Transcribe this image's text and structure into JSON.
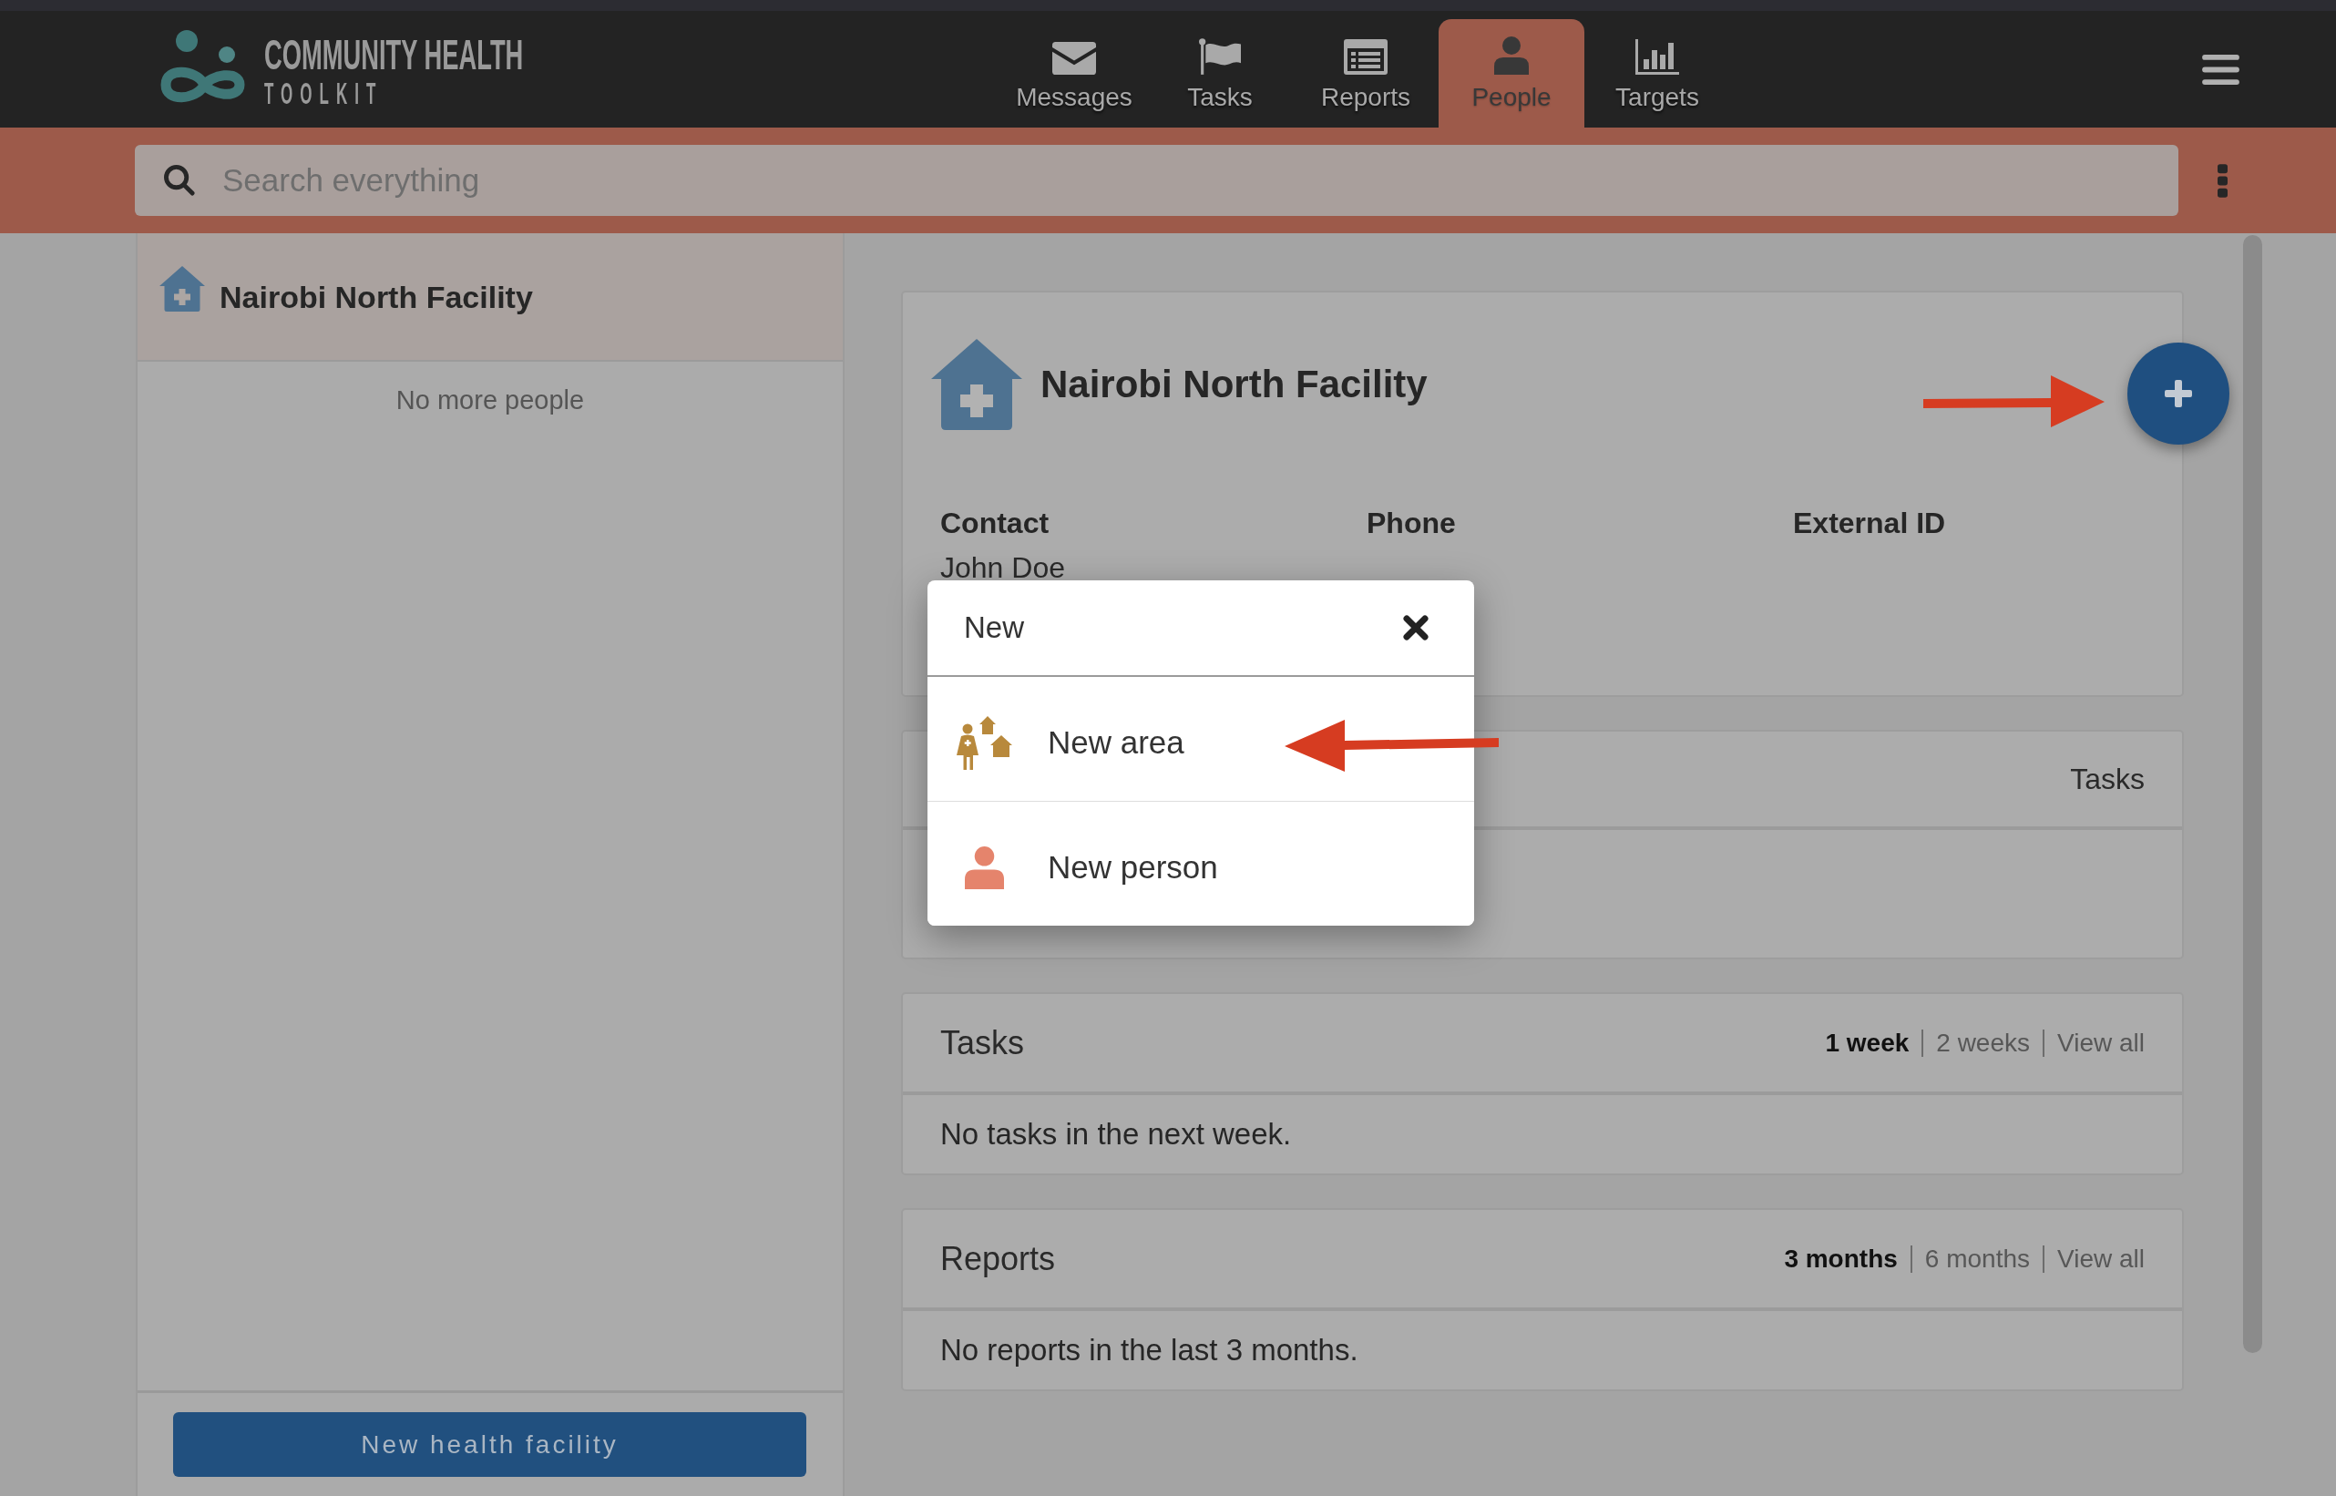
{
  "header": {
    "logo": {
      "line_1": "COMMUNITY HEALTH",
      "line_2": "TOOLKIT"
    },
    "tabs": [
      {
        "label": "Messages",
        "selected": false
      },
      {
        "label": "Tasks",
        "selected": false
      },
      {
        "label": "Reports",
        "selected": false
      },
      {
        "label": "People",
        "selected": true
      },
      {
        "label": "Targets",
        "selected": false
      }
    ]
  },
  "search": {
    "placeholder": "Search everything"
  },
  "sidebar": {
    "items": [
      {
        "name": "Nairobi North Facility",
        "selected": true
      }
    ],
    "empty_note": "No more people",
    "button": "New health facility"
  },
  "contact_card": {
    "name": "Nairobi North Facility",
    "fields": [
      {
        "label": "Contact",
        "value": "John Doe"
      },
      {
        "label": "Phone"
      },
      {
        "label": "External ID"
      }
    ]
  },
  "summary_card": {
    "header_right": "Tasks"
  },
  "tasks_card": {
    "title": "Tasks",
    "filters": [
      {
        "label": "1 week",
        "selected": true
      },
      {
        "label": "2 weeks",
        "selected": false
      },
      {
        "label": "View all",
        "selected": false
      }
    ],
    "empty_message": "No tasks in the next week."
  },
  "reports_card": {
    "title": "Reports",
    "filters": [
      {
        "label": "3 months",
        "selected": true
      },
      {
        "label": "6 months",
        "selected": false
      },
      {
        "label": "View all",
        "selected": false
      }
    ],
    "empty_message": "No reports in the last 3 months."
  },
  "new_dialog": {
    "title": "New",
    "items": [
      {
        "label": "New area"
      },
      {
        "label": "New person"
      }
    ]
  }
}
